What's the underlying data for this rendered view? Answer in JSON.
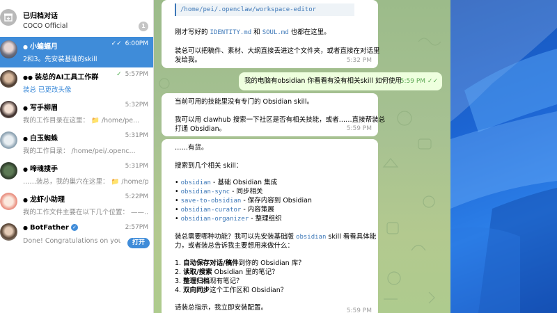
{
  "sidebar": {
    "archived": {
      "name": "已归档对话",
      "preview": "COCO Official",
      "badge": "1"
    },
    "chats": [
      {
        "name": "小蝙蝠月",
        "time": "6:00PM",
        "preview": "2和3。先安装基础的skill",
        "ticks": "✓✓"
      },
      {
        "name": "装总的AI工具工作群",
        "time": "5:57PM",
        "preview": "装总 已更改头像",
        "ticks": "✓"
      },
      {
        "name": "写手柳眉",
        "time": "5:32PM",
        "preview": "我的工作目录在这里： 📁 /home/pe..."
      },
      {
        "name": "白玉蜘蛛",
        "time": "5:31PM",
        "preview": "我的工作目录： /home/pei/.openc..."
      },
      {
        "name": "啼魂搜手",
        "time": "5:31PM",
        "preview": "……装总，我的巢穴在这里： 📁 /home/p..."
      },
      {
        "name": "龙虾小助理",
        "time": "5:22PM",
        "preview": "我的工作文件主要在以下几个位置： ——..."
      },
      {
        "name": "BotFather",
        "time": "2:57PM",
        "preview": "Done! Congratulations on your ...",
        "button": "打开"
      }
    ]
  },
  "messages": {
    "m1": {
      "path": "/home/pei/.openclaw/workspace-editor",
      "l1a": "刚才写好的 ",
      "l1code1": "IDENTITY.md",
      "l1b": " 和 ",
      "l1code2": "SOUL.md",
      "l1c": " 也都在这里。",
      "l2": "装总可以把稿件、素材、大纲直接丢进这个文件夹，或者直接在对话里",
      "l3": "发给我。",
      "time": "5:32 PM"
    },
    "m2": {
      "text": "我的电脑有obsidian 你看看有没有相关skill 如何使用",
      "time": "5:59 PM",
      "ticks": "✓✓"
    },
    "m3": {
      "l1": "当前可用的技能里没有专门的 Obsidian skill。",
      "l2": "我可以用 clawhub 搜索一下社区是否有相关技能，或者……直接帮装总",
      "l3": "打通 Obsidian。",
      "time": "5:59 PM"
    },
    "m4": {
      "l1": "……有货。",
      "l2": "搜索到几个相关 skill：",
      "skills": [
        {
          "code": "obsidian",
          "desc": " - 基础 Obsidian 集成"
        },
        {
          "code": "obsidian-sync",
          "desc": " - 同步相关"
        },
        {
          "code": "save-to-obsidian",
          "desc": " - 保存内容到 Obsidian"
        },
        {
          "code": "obsidian-curator",
          "desc": " - 内容策展"
        },
        {
          "code": "obsidian-organizer",
          "desc": " - 整理组织"
        }
      ],
      "q1a": "装总需要哪种功能？我可以先安装基础版 ",
      "q1code": "obsidian",
      "q1b": " skill 看看具体能",
      "q2": "力，或者装总告诉我主要想用来做什么：",
      "opts": [
        {
          "num": "1. ",
          "bold": "自动保存对话/稿件",
          "rest": "到你的 Obsidian 库？"
        },
        {
          "num": "2. ",
          "bold": "读取/搜索",
          "rest": " Obsidian 里的笔记？"
        },
        {
          "num": "3. ",
          "bold": "整理归档",
          "rest": "现有笔记？"
        },
        {
          "num": "4. ",
          "bold": "双向同步",
          "rest": "这个工作区和 Obsidian？"
        }
      ],
      "end": "请装总指示，我立即安装配置。",
      "time": "5:59 PM"
    }
  }
}
